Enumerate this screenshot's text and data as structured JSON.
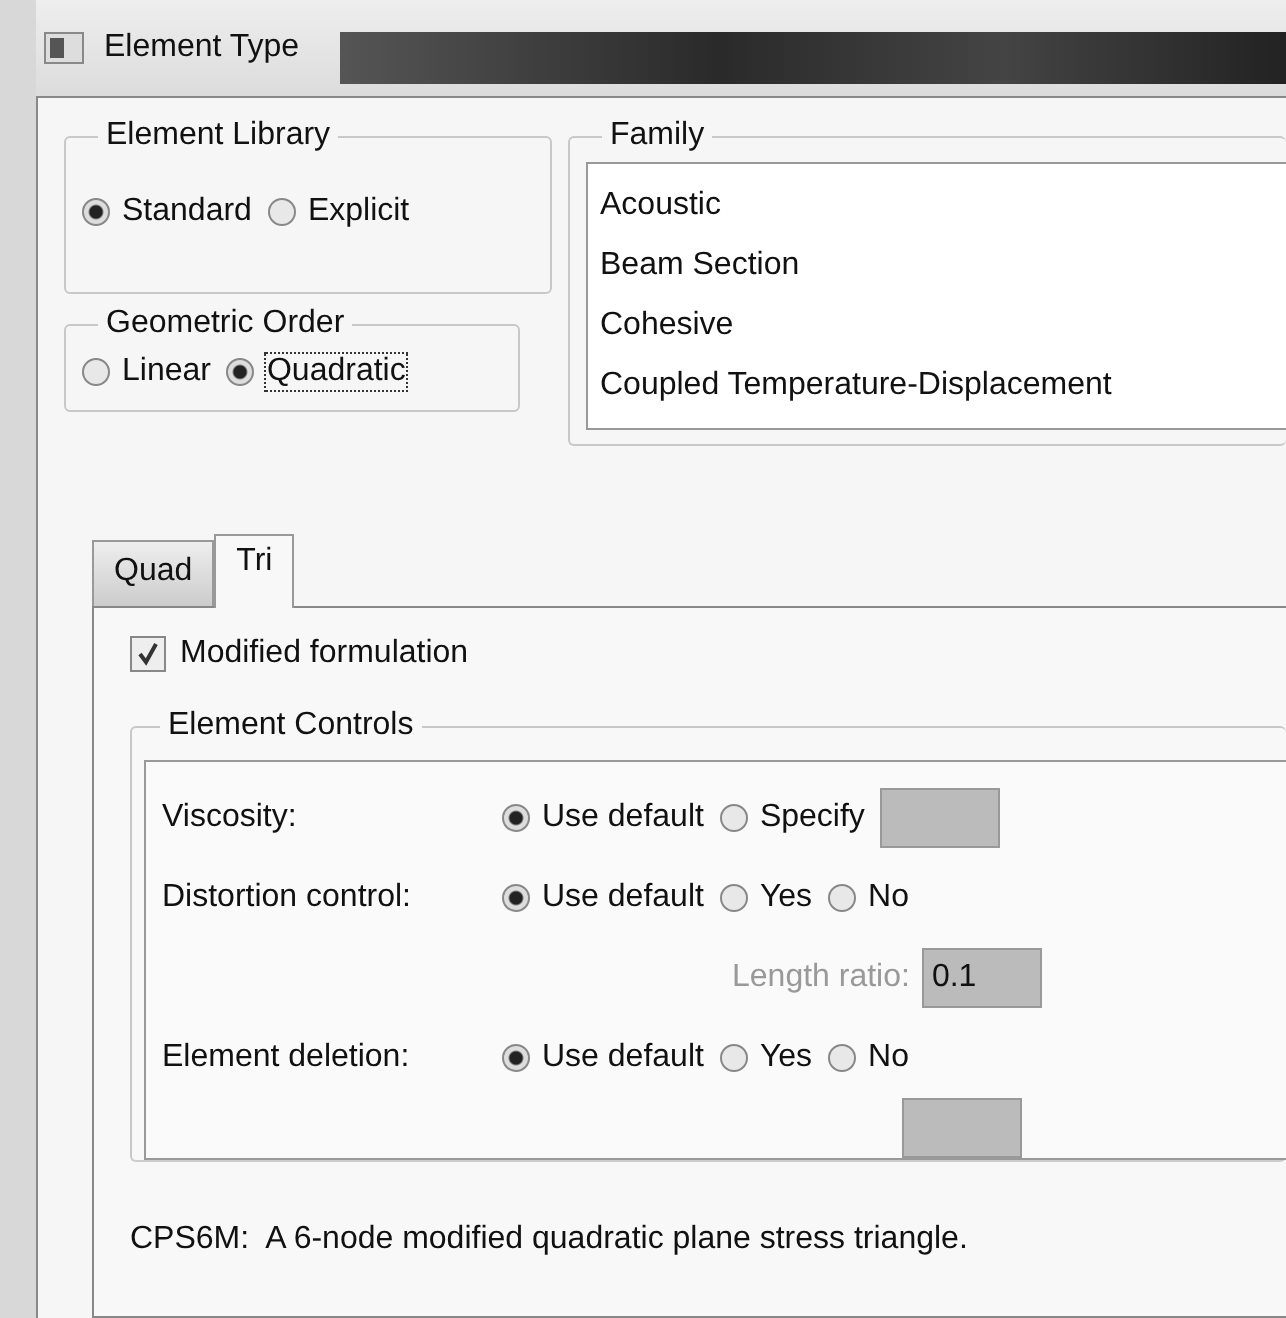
{
  "window": {
    "title": "Element Type"
  },
  "element_library": {
    "label": "Element Library",
    "options": [
      {
        "label": "Standard",
        "selected": true,
        "focused": false
      },
      {
        "label": "Explicit",
        "selected": false,
        "focused": false
      }
    ]
  },
  "geometric_order": {
    "label": "Geometric Order",
    "options": [
      {
        "label": "Linear",
        "selected": false,
        "focused": false
      },
      {
        "label": "Quadratic",
        "selected": true,
        "focused": true
      }
    ]
  },
  "family": {
    "label": "Family",
    "items": [
      "Acoustic",
      "Beam Section",
      "Cohesive",
      "Coupled Temperature-Displacement"
    ]
  },
  "tabs": [
    {
      "label": "Quad",
      "selected": false
    },
    {
      "label": "Tri",
      "selected": true
    }
  ],
  "modified_formulation": {
    "label": "Modified formulation",
    "checked": true
  },
  "element_controls": {
    "label": "Element Controls",
    "rows": [
      {
        "kind": "choice",
        "label": "Viscosity:",
        "options": [
          {
            "label": "Use default",
            "selected": true
          },
          {
            "label": "Specify",
            "selected": false
          }
        ],
        "trailing_field": true
      },
      {
        "kind": "choice",
        "label": "Distortion control:",
        "options": [
          {
            "label": "Use default",
            "selected": true
          },
          {
            "label": "Yes",
            "selected": false
          },
          {
            "label": "No",
            "selected": false
          }
        ]
      },
      {
        "kind": "field",
        "label": "Length ratio:",
        "value": "0.1",
        "disabled": true
      },
      {
        "kind": "choice",
        "label": "Element deletion:",
        "options": [
          {
            "label": "Use default",
            "selected": true
          },
          {
            "label": "Yes",
            "selected": false
          },
          {
            "label": "No",
            "selected": false
          }
        ]
      }
    ]
  },
  "description": "CPS6M:  A 6-node modified quadratic plane stress triangle."
}
